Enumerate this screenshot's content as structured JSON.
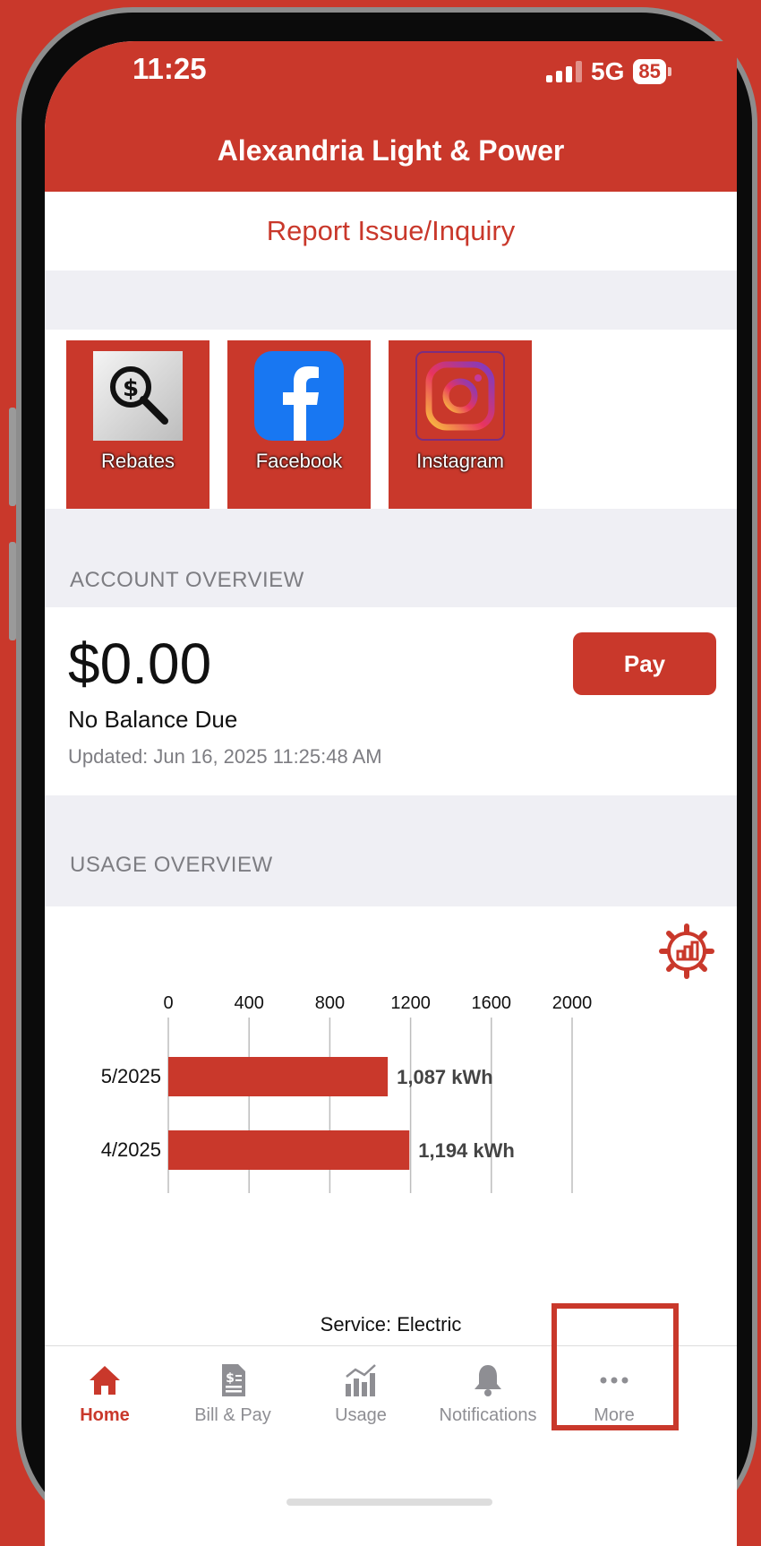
{
  "status_bar": {
    "time": "11:25",
    "network": "5G",
    "battery": "85"
  },
  "header": {
    "title": "Alexandria Light & Power"
  },
  "report_link": "Report Issue/Inquiry",
  "tiles": [
    {
      "label": "Rebates",
      "icon": "rebates-magnifier-dollar-icon"
    },
    {
      "label": "Facebook",
      "icon": "facebook-icon"
    },
    {
      "label": "Instagram",
      "icon": "instagram-icon"
    }
  ],
  "account_overview": {
    "section_label": "ACCOUNT OVERVIEW",
    "amount": "$0.00",
    "balance_text": "No Balance Due",
    "updated": "Updated: Jun 16, 2025 11:25:48 AM",
    "pay_label": "Pay"
  },
  "usage_overview": {
    "section_label": "USAGE OVERVIEW",
    "service": "Service: Electric",
    "settings_icon": "chart-settings-gear-icon"
  },
  "chart_data": {
    "type": "bar",
    "orientation": "horizontal",
    "categories": [
      "5/2025",
      "4/2025"
    ],
    "values": [
      1087,
      1194
    ],
    "value_labels": [
      "1,087 kWh",
      "1,194 kWh"
    ],
    "x_ticks": [
      "0",
      "400",
      "800",
      "1200",
      "1600",
      "2000"
    ],
    "xlim": [
      0,
      2000
    ],
    "grid": true,
    "color": "#c9382b"
  },
  "tabbar": {
    "items": [
      {
        "label": "Home",
        "icon": "home-icon",
        "active": true
      },
      {
        "label": "Bill & Pay",
        "icon": "bill-icon",
        "active": false
      },
      {
        "label": "Usage",
        "icon": "usage-chart-icon",
        "active": false
      },
      {
        "label": "Notifications",
        "icon": "bell-icon",
        "active": false
      },
      {
        "label": "More",
        "icon": "more-dots-icon",
        "active": false
      }
    ]
  },
  "colors": {
    "brand": "#c9382b",
    "section_bg": "#efeff4",
    "muted_text": "#7d7d82"
  }
}
